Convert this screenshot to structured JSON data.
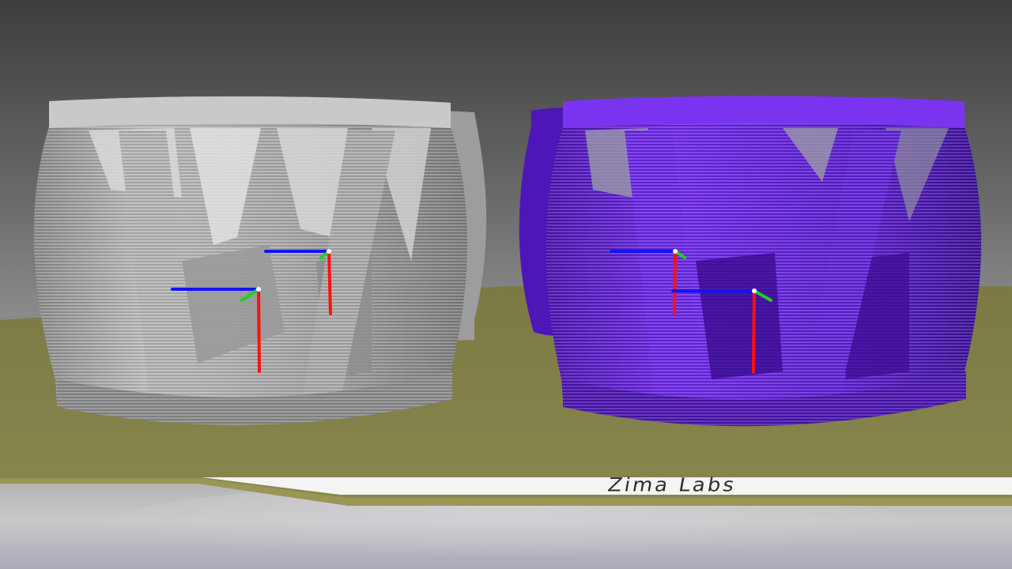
{
  "scene": {
    "plate_label": "Zima Labs",
    "objects": [
      {
        "name": "gray-cage-part",
        "color": "#b9b9b9"
      },
      {
        "name": "purple-cage-part",
        "color": "#6b22e6"
      }
    ],
    "axis_colors": {
      "x": "#1212ff",
      "y": "#20d020",
      "z": "#ff1010"
    }
  }
}
